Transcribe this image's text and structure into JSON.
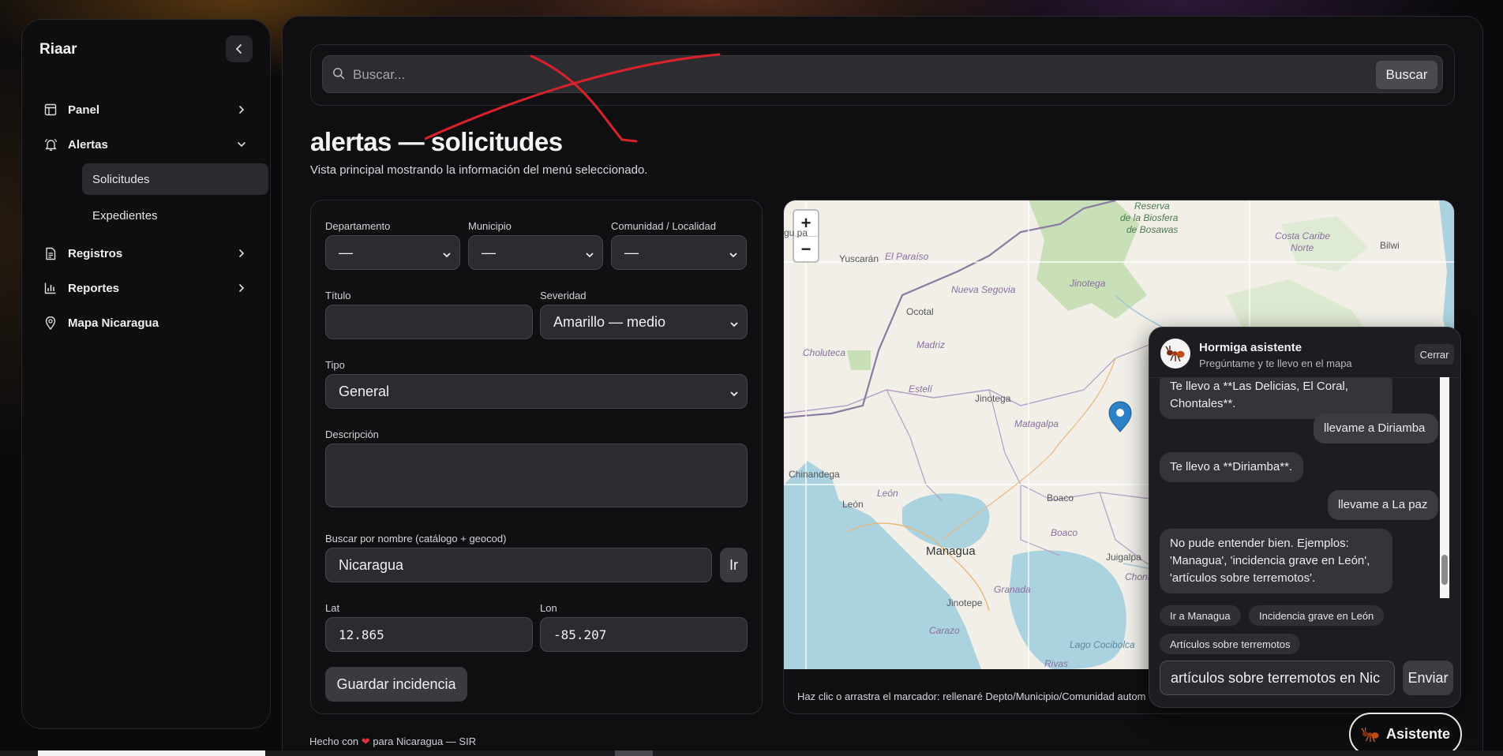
{
  "sidebar": {
    "brand": "Riaar",
    "items": [
      {
        "label": "Panel"
      },
      {
        "label": "Alertas",
        "subitems": [
          {
            "label": "Solicitudes",
            "active": true
          },
          {
            "label": "Expedientes"
          }
        ]
      },
      {
        "label": "Registros"
      },
      {
        "label": "Reportes"
      },
      {
        "label": "Mapa Nicaragua"
      }
    ]
  },
  "search": {
    "placeholder": "Buscar...",
    "button": "Buscar"
  },
  "page": {
    "title": "alertas — solicitudes",
    "subtitle": "Vista principal mostrando la información del menú seleccionado."
  },
  "form": {
    "departamento": {
      "label": "Departamento",
      "value": "—"
    },
    "municipio": {
      "label": "Municipio",
      "value": "—"
    },
    "comunidad": {
      "label": "Comunidad / Localidad",
      "value": "—"
    },
    "titulo": {
      "label": "Título",
      "value": ""
    },
    "severidad": {
      "label": "Severidad",
      "value": "Amarillo — medio"
    },
    "tipo": {
      "label": "Tipo",
      "value": "General"
    },
    "descripcion": {
      "label": "Descripción",
      "value": ""
    },
    "buscar_nombre": {
      "label": "Buscar por nombre (catálogo + geocod)",
      "value": "Nicaragua",
      "button": "Ir"
    },
    "lat": {
      "label": "Lat",
      "value": "12.865"
    },
    "lon": {
      "label": "Lon",
      "value": "-85.207"
    },
    "save_button": "Guardar incidencia"
  },
  "map": {
    "zoom_in": "+",
    "zoom_out": "−",
    "note": "Haz clic o arrastra el marcador: rellenaré Depto/Municipio/Comunidad autom",
    "labels": {
      "gupa": "gu pa",
      "yuscaran": "Yuscarán",
      "el_paraiso": "El Paraíso",
      "nueva_segovia": "Nueva Segovia",
      "ocotal": "Ocotal",
      "madriz": "Madriz",
      "choluteca": "Choluteca",
      "esteli_dept": "Estelí",
      "jinotega_dept": "Jinotega",
      "jinotega": "Jinotega",
      "matagalpa": "Matagalpa",
      "chinandega": "Chinandega",
      "leon_dept": "León",
      "leon": "León",
      "boaco": "Boaco",
      "boaco_dept": "Boaco",
      "managua": "Managua",
      "juigalpa": "Juigalpa",
      "chontales": "Chontales",
      "jinotepe": "Jinotepe",
      "granada": "Granada",
      "carazo": "Carazo",
      "lago": "Lago Cocibolca",
      "rivas": "Rivas",
      "reserva": "Reserva",
      "biosfera": "de la Biosfera",
      "bosawas": "de Bosawas",
      "costa_caribe": "Costa Caribe",
      "norte": "Norte",
      "bilwi": "Bilwi"
    }
  },
  "assistant": {
    "title": "Hormiga asistente",
    "subtitle": "Pregúntame y te llevo en el mapa",
    "close": "Cerrar",
    "messages": [
      {
        "role": "bot",
        "text": "Te llevo a **Las Delicias, El Coral, Chontales**."
      },
      {
        "role": "user",
        "text": "llevame a Diriamba"
      },
      {
        "role": "bot",
        "text": "Te llevo a **Diriamba**."
      },
      {
        "role": "user",
        "text": "llevame a La paz"
      },
      {
        "role": "bot",
        "text": "No pude entender bien. Ejemplos: 'Managua', 'incidencia grave en León', 'artículos sobre terremotos'."
      }
    ],
    "chips": [
      "Ir a Managua",
      "Incidencia grave en León",
      "Artículos sobre terremotos"
    ],
    "input_value": "artículos sobre terremotos en Nic",
    "send": "Enviar",
    "fab": "Asistente"
  },
  "footer": {
    "before": "Hecho con",
    "heart": "❤",
    "after": "para Nicaragua — SIR"
  }
}
